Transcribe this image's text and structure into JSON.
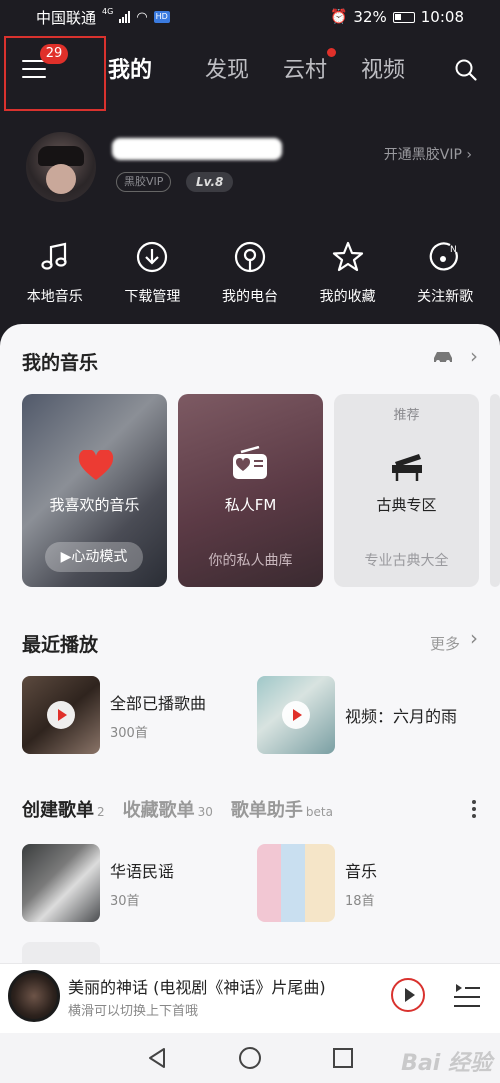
{
  "status_bar": {
    "carrier": "中国联通",
    "network": "4G",
    "battery": "32%",
    "time": "10:08"
  },
  "header": {
    "menu_badge": "29",
    "tabs": [
      {
        "label": "我的",
        "active": true
      },
      {
        "label": "发现",
        "active": false
      },
      {
        "label": "云村",
        "active": false,
        "dot": true
      },
      {
        "label": "视频",
        "active": false
      }
    ]
  },
  "profile": {
    "vip_badge": "黑胶VIP",
    "level": "Lv.8",
    "open_vip": "开通黑胶VIP ›"
  },
  "quick_actions": [
    {
      "label": "本地音乐",
      "icon": "music-note-icon"
    },
    {
      "label": "下载管理",
      "icon": "download-icon"
    },
    {
      "label": "我的电台",
      "icon": "podcast-icon"
    },
    {
      "label": "我的收藏",
      "icon": "star-icon"
    },
    {
      "label": "关注新歌",
      "icon": "new-song-icon"
    }
  ],
  "my_music": {
    "title": "我的音乐",
    "cards": [
      {
        "title": "我喜欢的音乐",
        "button": "▶心动模式"
      },
      {
        "title": "私人FM",
        "subtitle": "你的私人曲库"
      },
      {
        "tag": "推荐",
        "title": "古典专区",
        "subtitle": "专业古典大全"
      }
    ]
  },
  "recent": {
    "title": "最近播放",
    "more": "更多",
    "items": [
      {
        "name": "全部已播歌曲",
        "count": "300首"
      },
      {
        "name": "视频：六月的雨",
        "count": ""
      }
    ]
  },
  "playlists": {
    "tabs": [
      {
        "label": "创建歌单",
        "count": "2",
        "active": true
      },
      {
        "label": "收藏歌单",
        "count": "30",
        "active": false
      },
      {
        "label": "歌单助手",
        "count": "beta",
        "active": false
      }
    ],
    "items": [
      {
        "name": "华语民谣",
        "count": "30首"
      },
      {
        "name": "音乐",
        "count": "18首"
      }
    ]
  },
  "player": {
    "title": "美丽的神话 (电视剧《神话》片尾曲)",
    "subtitle": "横滑可以切换上下首哦"
  },
  "watermark": "Bai 经验",
  "colors": {
    "accent": "#e0302a",
    "dark_bg": "#1d1c22",
    "sheet_bg": "#f7f7f9"
  }
}
